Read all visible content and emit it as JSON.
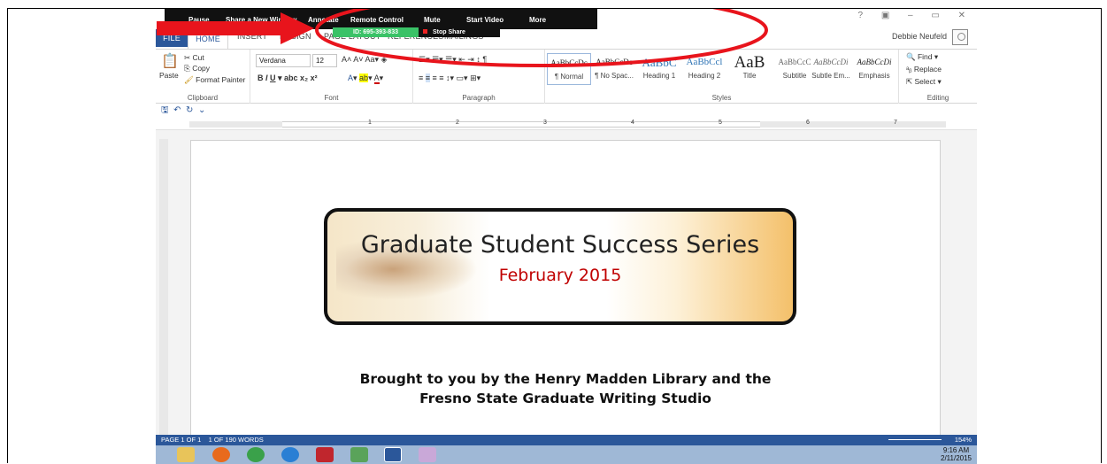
{
  "zoom_toolbar": {
    "items": [
      "Pause",
      "Share a New Window",
      "Annotate",
      "Remote Control",
      "Mute",
      "Start Video",
      "More"
    ],
    "meeting_id": "ID: 695-393-833",
    "stop_share": "Stop Share"
  },
  "title_bar": {
    "user": "Debbie Neufeld"
  },
  "tabs": [
    "FILE",
    "HOME",
    "INSERT",
    "DESIGN",
    "PAGE LAYOUT",
    "REFERENCES",
    "MAILINGS"
  ],
  "ribbon": {
    "clipboard": {
      "paste": "Paste",
      "cut": "Cut",
      "copy": "Copy",
      "format_painter": "Format Painter",
      "label": "Clipboard"
    },
    "font": {
      "name": "Verdana",
      "size": "12",
      "label": "Font"
    },
    "paragraph": {
      "label": "Paragraph"
    },
    "styles": {
      "label": "Styles",
      "items": [
        {
          "preview": "AaBbCcDc",
          "name": "¶ Normal"
        },
        {
          "preview": "AaBbCcDc",
          "name": "¶ No Spac..."
        },
        {
          "preview": "AaBbC",
          "name": "Heading 1"
        },
        {
          "preview": "AaBbCcl",
          "name": "Heading 2"
        },
        {
          "preview": "AaB",
          "name": "Title"
        },
        {
          "preview": "AaBbCcC",
          "name": "Subtitle"
        },
        {
          "preview": "AaBbCcDi",
          "name": "Subtle Em..."
        },
        {
          "preview": "AaBbCcDi",
          "name": "Emphasis"
        }
      ]
    },
    "editing": {
      "find": "Find",
      "replace": "Replace",
      "select": "Select",
      "label": "Editing"
    }
  },
  "ruler": {
    "numbers": [
      "1",
      "2",
      "3",
      "4",
      "5",
      "6",
      "7"
    ]
  },
  "document": {
    "banner_title": "Graduate Student Success Series",
    "banner_subtitle": "February 2015",
    "brought_line1": "Brought to you by the Henry Madden Library and the",
    "brought_line2": "Fresno State Graduate Writing Studio"
  },
  "status_bar": {
    "page": "PAGE 1 OF 1",
    "words": "1 OF 190 WORDS",
    "zoom": "154%"
  },
  "taskbar": {
    "time": "9:16 AM",
    "date": "2/11/2015"
  },
  "colors": {
    "word_blue": "#2b579a",
    "annotation_red": "#e8141c",
    "zoom_green": "#3ac267",
    "subtitle_red": "#c00000"
  }
}
